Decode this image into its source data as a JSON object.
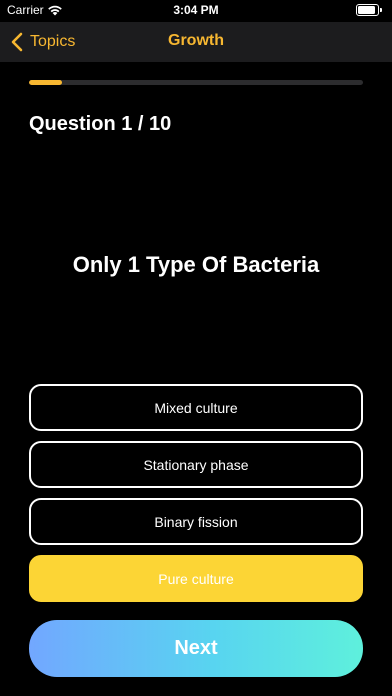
{
  "status_bar": {
    "carrier": "Carrier",
    "time": "3:04 PM",
    "wifi_icon": "wifi-icon",
    "battery_icon": "battery-icon"
  },
  "nav": {
    "back_label": "Topics",
    "back_icon": "chevron-left-icon",
    "title": "Growth",
    "accent_color": "#f7b731",
    "background_color": "#1c1c1e"
  },
  "quiz": {
    "progress_fraction": 0.1,
    "counter": "Question 1 / 10",
    "question": "Only 1 Type Of Bacteria",
    "answers": [
      {
        "label": "Mixed culture",
        "selected": false
      },
      {
        "label": "Stationary phase",
        "selected": false
      },
      {
        "label": "Binary fission",
        "selected": false
      },
      {
        "label": "Pure culture",
        "selected": true
      }
    ],
    "selected_color": "#fcd535",
    "next_label": "Next"
  }
}
